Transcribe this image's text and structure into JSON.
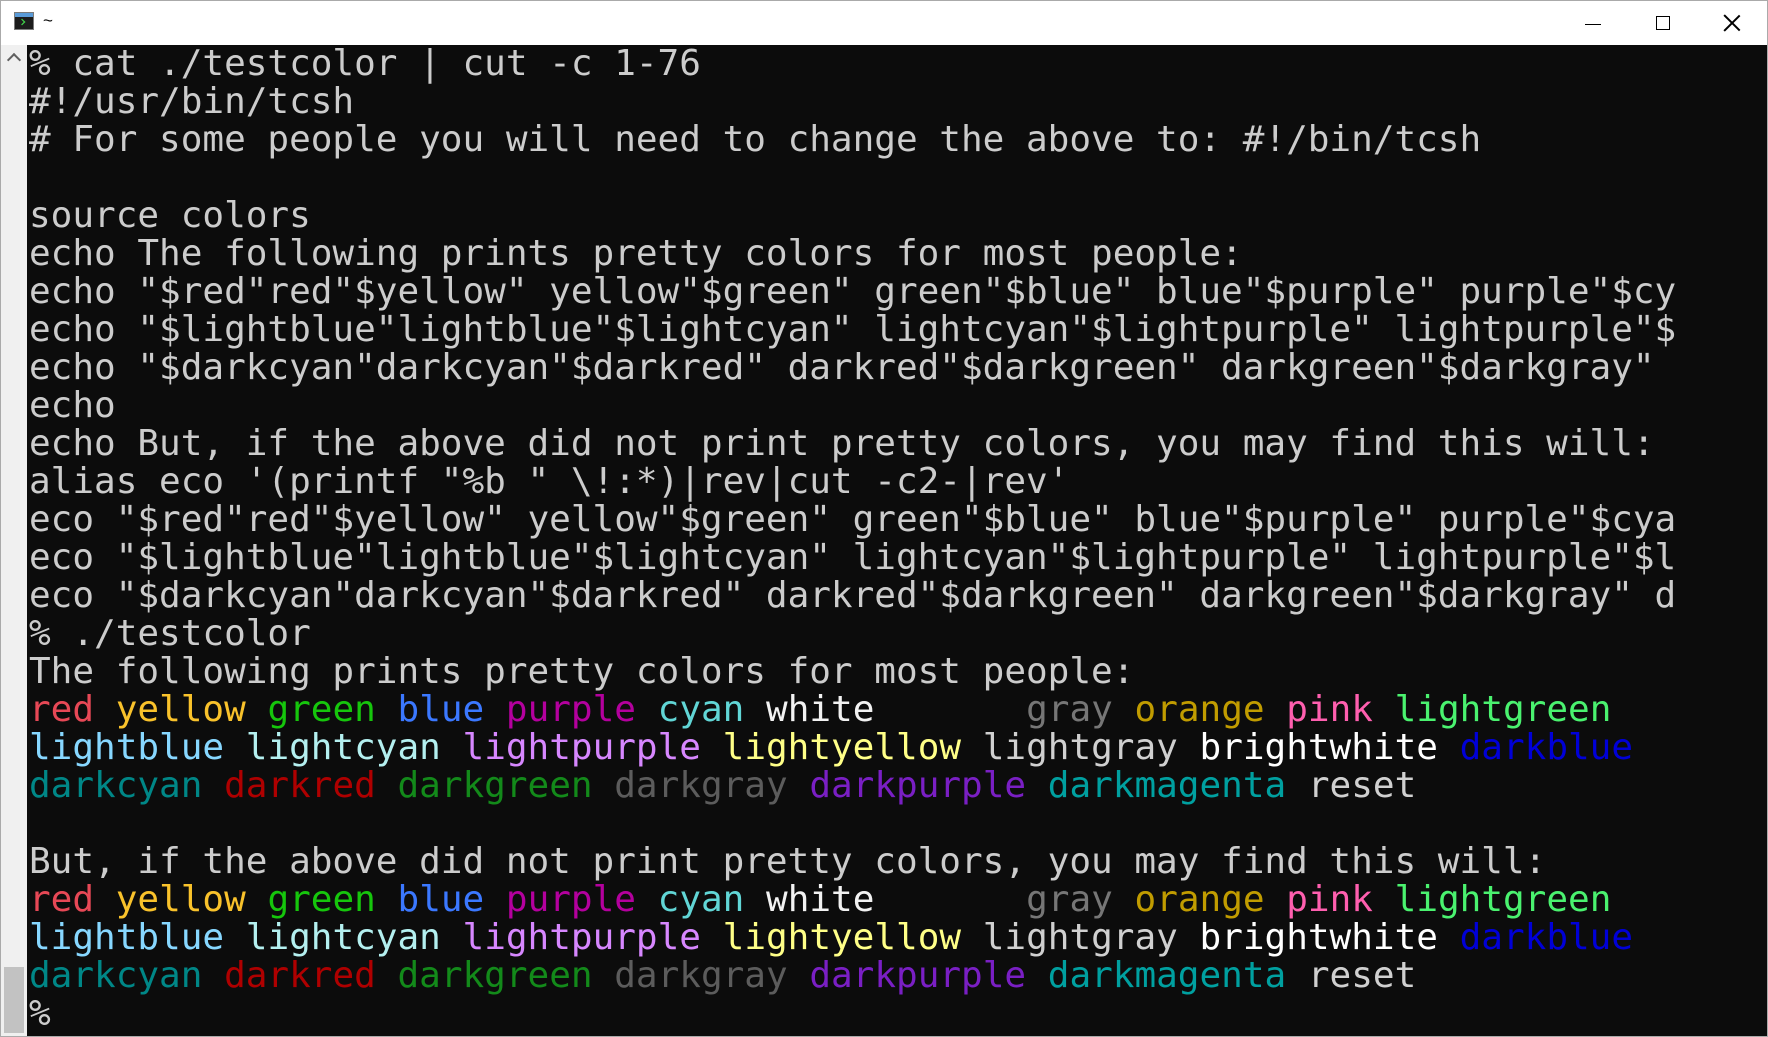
{
  "window": {
    "title": "~",
    "app_icon": "terminal-icon",
    "controls": [
      "minimize-icon",
      "maximize-icon",
      "close-icon"
    ]
  },
  "colors": {
    "background": "#0c0c0c",
    "foreground": "#cccccc",
    "red": "#e74856",
    "yellow": "#f9c22b",
    "green": "#16c60c",
    "blue": "#3b78ff",
    "purple": "#b4009e",
    "cyan": "#61d6d6",
    "white": "#f2f2f2",
    "gray": "#767676",
    "orange": "#c19c00",
    "pink": "#ff5faf",
    "lightgreen": "#4af26f",
    "lightblue": "#87d7ff",
    "lightpurple": "#d787ff",
    "lightyellow": "#ffff87",
    "darkblue": "#0000d7"
  },
  "terminal": {
    "lines": [
      [
        {
          "t": "% cat ./testcolor | cut -c 1-76"
        }
      ],
      [
        {
          "t": "#!/usr/bin/tcsh"
        }
      ],
      [
        {
          "t": "# For some people you will need to change the above to: #!/bin/tcsh"
        }
      ],
      [
        {
          "t": ""
        }
      ],
      [
        {
          "t": "source colors"
        }
      ],
      [
        {
          "t": "echo The following prints pretty colors for most people:"
        }
      ],
      [
        {
          "t": "echo \"$red\"red\"$yellow\" yellow\"$green\" green\"$blue\" blue\"$purple\" purple\"$cy"
        }
      ],
      [
        {
          "t": "echo \"$lightblue\"lightblue\"$lightcyan\" lightcyan\"$lightpurple\" lightpurple\"$"
        }
      ],
      [
        {
          "t": "echo \"$darkcyan\"darkcyan\"$darkred\" darkred\"$darkgreen\" darkgreen\"$darkgray\""
        }
      ],
      [
        {
          "t": "echo"
        }
      ],
      [
        {
          "t": "echo But, if the above did not print pretty colors, you may find this will:"
        }
      ],
      [
        {
          "t": "alias eco '(printf \"%b \" \\!:*)|rev|cut -c2-|rev'"
        }
      ],
      [
        {
          "t": "eco \"$red\"red\"$yellow\" yellow\"$green\" green\"$blue\" blue\"$purple\" purple\"$cya"
        }
      ],
      [
        {
          "t": "eco \"$lightblue\"lightblue\"$lightcyan\" lightcyan\"$lightpurple\" lightpurple\"$l"
        }
      ],
      [
        {
          "t": "eco \"$darkcyan\"darkcyan\"$darkred\" darkred\"$darkgreen\" darkgreen\"$darkgray\" d"
        }
      ],
      [
        {
          "t": "% ./testcolor"
        }
      ],
      [
        {
          "t": "The following prints pretty colors for most people:"
        }
      ],
      [
        {
          "t": "red",
          "c": "#e74856"
        },
        {
          "t": " "
        },
        {
          "t": "yellow",
          "c": "#f9c22b"
        },
        {
          "t": " "
        },
        {
          "t": "green",
          "c": "#16c60c"
        },
        {
          "t": " "
        },
        {
          "t": "blue",
          "c": "#3b78ff"
        },
        {
          "t": " "
        },
        {
          "t": "purple",
          "c": "#b4009e"
        },
        {
          "t": " "
        },
        {
          "t": "cyan",
          "c": "#61d6d6"
        },
        {
          "t": " "
        },
        {
          "t": "white",
          "c": "#f2f2f2"
        },
        {
          "t": "       "
        },
        {
          "t": "gray",
          "c": "#767676"
        },
        {
          "t": " "
        },
        {
          "t": "orange",
          "c": "#c19c00"
        },
        {
          "t": " "
        },
        {
          "t": "pink",
          "c": "#ff5faf"
        },
        {
          "t": " "
        },
        {
          "t": "lightgreen",
          "c": "#4af26f"
        }
      ],
      [
        {
          "t": "lightblue",
          "c": "#87d7ff"
        },
        {
          "t": " "
        },
        {
          "t": "lightcyan",
          "c": "#b4f0f0"
        },
        {
          "t": " "
        },
        {
          "t": "lightpurple",
          "c": "#d787ff"
        },
        {
          "t": " "
        },
        {
          "t": "lightyellow",
          "c": "#ffff87"
        },
        {
          "t": " "
        },
        {
          "t": "lightgray",
          "c": "#d0d0d0"
        },
        {
          "t": " "
        },
        {
          "t": "brightwhite",
          "c": "#ffffff"
        },
        {
          "t": " "
        },
        {
          "t": "darkblue",
          "c": "#0000d7"
        }
      ],
      [
        {
          "t": "darkcyan",
          "c": "#008787"
        },
        {
          "t": " "
        },
        {
          "t": "darkred",
          "c": "#af0000"
        },
        {
          "t": " "
        },
        {
          "t": "darkgreen",
          "c": "#138a1a"
        },
        {
          "t": " "
        },
        {
          "t": "darkgray",
          "c": "#5c5c5c"
        },
        {
          "t": " "
        },
        {
          "t": "darkpurple",
          "c": "#7a1fc4"
        },
        {
          "t": " "
        },
        {
          "t": "darkmagenta",
          "c": "#00a0a0"
        },
        {
          "t": " "
        },
        {
          "t": "reset",
          "c": "#d0d0d0"
        }
      ],
      [
        {
          "t": ""
        }
      ],
      [
        {
          "t": "But, if the above did not print pretty colors, you may find this will:"
        }
      ],
      [
        {
          "t": "red",
          "c": "#e74856"
        },
        {
          "t": " "
        },
        {
          "t": "yellow",
          "c": "#f9c22b"
        },
        {
          "t": " "
        },
        {
          "t": "green",
          "c": "#16c60c"
        },
        {
          "t": " "
        },
        {
          "t": "blue",
          "c": "#3b78ff"
        },
        {
          "t": " "
        },
        {
          "t": "purple",
          "c": "#b4009e"
        },
        {
          "t": " "
        },
        {
          "t": "cyan",
          "c": "#61d6d6"
        },
        {
          "t": " "
        },
        {
          "t": "white",
          "c": "#f2f2f2"
        },
        {
          "t": "       "
        },
        {
          "t": "gray",
          "c": "#767676"
        },
        {
          "t": " "
        },
        {
          "t": "orange",
          "c": "#c19c00"
        },
        {
          "t": " "
        },
        {
          "t": "pink",
          "c": "#ff5faf"
        },
        {
          "t": " "
        },
        {
          "t": "lightgreen",
          "c": "#4af26f"
        }
      ],
      [
        {
          "t": "lightblue",
          "c": "#87d7ff"
        },
        {
          "t": " "
        },
        {
          "t": "lightcyan",
          "c": "#b4f0f0"
        },
        {
          "t": " "
        },
        {
          "t": "lightpurple",
          "c": "#d787ff"
        },
        {
          "t": " "
        },
        {
          "t": "lightyellow",
          "c": "#ffff87"
        },
        {
          "t": " "
        },
        {
          "t": "lightgray",
          "c": "#d0d0d0"
        },
        {
          "t": " "
        },
        {
          "t": "brightwhite",
          "c": "#ffffff"
        },
        {
          "t": " "
        },
        {
          "t": "darkblue",
          "c": "#0000d7"
        }
      ],
      [
        {
          "t": "darkcyan",
          "c": "#008787"
        },
        {
          "t": " "
        },
        {
          "t": "darkred",
          "c": "#af0000"
        },
        {
          "t": " "
        },
        {
          "t": "darkgreen",
          "c": "#138a1a"
        },
        {
          "t": " "
        },
        {
          "t": "darkgray",
          "c": "#5c5c5c"
        },
        {
          "t": " "
        },
        {
          "t": "darkpurple",
          "c": "#7a1fc4"
        },
        {
          "t": " "
        },
        {
          "t": "darkmagenta",
          "c": "#00a0a0"
        },
        {
          "t": " "
        },
        {
          "t": "reset",
          "c": "#d0d0d0"
        }
      ],
      [
        {
          "t": "%"
        }
      ]
    ]
  }
}
